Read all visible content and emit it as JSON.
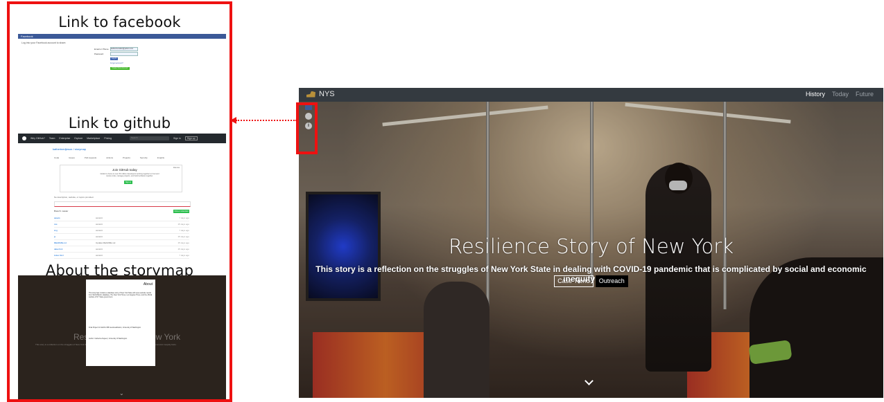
{
  "callout": {
    "facebook_caption": "Link to facebook",
    "github_caption": "Link to github",
    "about_caption": "About the storymap",
    "facebook": {
      "bar_label": "Facebook",
      "message": "Log into your Facebook account to share.",
      "email_label": "Email or Phone",
      "email_value": "katherinezeller@yahoo.com",
      "password_label": "Password",
      "login_label": "Log In",
      "forgot_label": "Forgot account?",
      "create_label": "Create New Account"
    },
    "github": {
      "nav": [
        "Why GitHub?",
        "Team",
        "Enterprise",
        "Explore",
        "Marketplace",
        "Pricing"
      ],
      "search_placeholder": "Search",
      "signin": "Sign in",
      "signup": "Sign up",
      "repo": "katherinedjeson / storymap",
      "tabs": [
        "Code",
        "Issues",
        "Pull requests",
        "Actions",
        "Projects",
        "Security",
        "Insights"
      ],
      "join_title": "Join GitHub today",
      "join_desc": "GitHub is home to over 50 million developers working together to host and review code, manage projects, and build software together.",
      "signup_btn": "Sign up",
      "dismiss": "Dismiss",
      "no_description": "No description, website, or topics provided.",
      "branch": "Branch: master",
      "clone_btn": "Clone or download",
      "files": [
        {
          "name": "assets",
          "msg": "commit",
          "time": "7 days ago"
        },
        {
          "name": "css",
          "msg": "commit",
          "time": "25 days ago"
        },
        {
          "name": "img",
          "msg": "commit",
          "time": "7 days ago"
        },
        {
          "name": "js",
          "msg": "commit",
          "time": "25 days ago"
        },
        {
          "name": "README.md",
          "msg": "Update README.md",
          "time": "25 days ago"
        },
        {
          "name": "data.html",
          "msg": "commit",
          "time": "25 days ago"
        },
        {
          "name": "index.html",
          "msg": "commit",
          "time": "7 days ago"
        }
      ]
    },
    "about": {
      "title": "About",
      "p1": "This storymap contains a datebase story of New York State with open-website results from World Bank's database, The New York Times, Los Angeles Times, and the official website of NY State government.",
      "p2": "Final Project for GEOG 458 Geovisualization, University of Washington",
      "p3": "Author: Catherine Dejsen | University of Washington",
      "bg_title": "Resilience Story of New York",
      "bg_sub": "This story is a reflection on the struggles of New York State in dealing with COVID-19 pandemic that is complicated by social and economic inequity facts."
    }
  },
  "story": {
    "brand": "NYS",
    "nav": [
      {
        "label": "History",
        "active": true
      },
      {
        "label": "Today",
        "active": false
      },
      {
        "label": "Future",
        "active": false
      }
    ],
    "title": "Resilience Story of New York",
    "subtitle": "This story is a reflection on the struggles of New York State in dealing with COVID-19 pandemic that is complicated by social and economic inequity facts.",
    "btn_case": "Case Trend",
    "btn_outreach": "Outreach",
    "info_icon_glyph": "i",
    "icons": [
      "facebook-icon",
      "github-icon",
      "info-icon",
      "chevron-down-icon",
      "new-york-state-icon"
    ]
  },
  "colors": {
    "highlight": "#ee1111",
    "navbar": "#343a40",
    "facebook_blue": "#3b5998",
    "github_dark": "#24292e",
    "github_green": "#2cbe4e"
  }
}
